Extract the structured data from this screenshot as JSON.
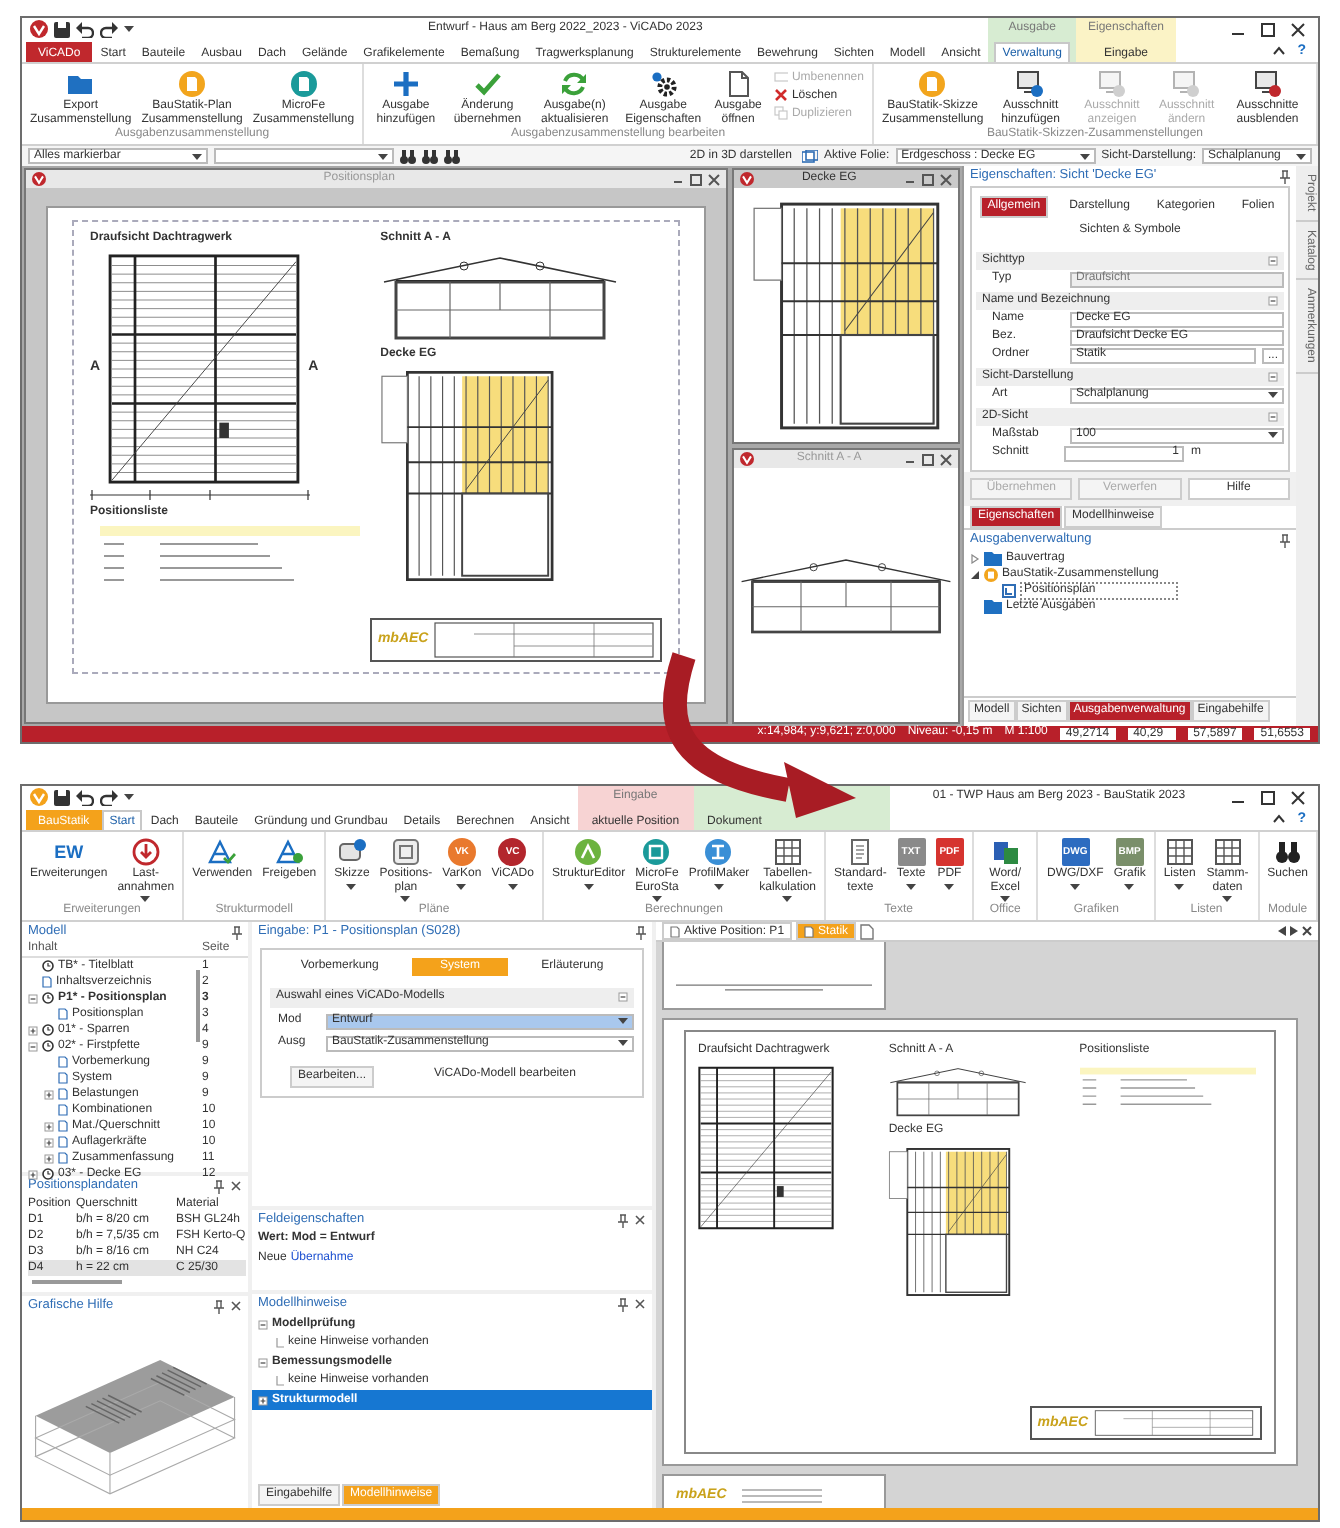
{
  "top_window": {
    "title": "Entwurf - Haus am Berg 2022_2023 - ViCADo 2023",
    "app_tab": "ViCADo",
    "help": "?",
    "tabs": [
      {
        "label": "Start",
        "selected": false
      },
      {
        "label": "Bauteile",
        "selected": false
      },
      {
        "label": "Ausbau",
        "selected": false
      },
      {
        "label": "Dach",
        "selected": false
      },
      {
        "label": "Gelände",
        "selected": false
      },
      {
        "label": "Grafikelemente",
        "selected": false
      },
      {
        "label": "Bemaßung",
        "selected": false
      },
      {
        "label": "Tragwerksplanung",
        "selected": false
      },
      {
        "label": "Strukturelemente",
        "selected": false
      },
      {
        "label": "Bewehrung",
        "selected": false
      },
      {
        "label": "Sichten",
        "selected": false
      },
      {
        "label": "Modell",
        "selected": false
      },
      {
        "label": "Ansicht",
        "selected": false
      }
    ],
    "context_tabs": [
      {
        "group": "Ausgabe",
        "label": "Verwaltung",
        "selected": true,
        "color": "#d7ecd2"
      },
      {
        "group": "Eigenschaften",
        "label": "Eingabe",
        "selected": false,
        "color": "#fbf3c6"
      }
    ],
    "ribbon": [
      {
        "label": "Ausgabenzusammenstellung",
        "buttons": [
          {
            "label": "Export Zusammenstellung",
            "disabled": false
          },
          {
            "label": "BauStatik-Plan Zusammenstellung",
            "disabled": false
          },
          {
            "label": "MicroFe Zusammenstellung",
            "disabled": false
          }
        ]
      },
      {
        "label": "Ausgabenzusammenstellung bearbeiten",
        "buttons": [
          {
            "label": "Ausgabe hinzufügen",
            "disabled": false
          },
          {
            "label": "Änderung übernehmen",
            "disabled": false
          },
          {
            "label": "Ausgabe(n) aktualisieren",
            "disabled": false
          },
          {
            "label": "Ausgabe Eigenschaften",
            "disabled": false
          },
          {
            "label": "Ausgabe öffnen",
            "disabled": false
          }
        ],
        "small_buttons": [
          {
            "label": "Umbenennen",
            "disabled": true
          },
          {
            "label": "Löschen",
            "disabled": false
          },
          {
            "label": "Duplizieren",
            "disabled": true
          }
        ]
      },
      {
        "label": "BauStatik-Skizzen-Zusammenstellungen",
        "buttons": [
          {
            "label": "BauStatik-Skizze Zusammenstellung",
            "disabled": false
          },
          {
            "label": "Ausschnitt hinzufügen",
            "disabled": false
          },
          {
            "label": "Ausschnitt anzeigen",
            "disabled": true
          },
          {
            "label": "Ausschnitt ändern",
            "disabled": true
          },
          {
            "label": "Ausschnitte ausblenden",
            "disabled": false
          }
        ]
      }
    ],
    "toolbar": {
      "filter": "Alles markierbar",
      "view_3d": "2D in 3D darstellen",
      "layer_label": "Aktive Folie:",
      "layer": "Erdgeschoss : Decke EG",
      "display_label": "Sicht-Darstellung:",
      "display": "Schalplanung"
    },
    "plan_window": {
      "title": "Positionsplan",
      "sheet": {
        "plan_title": "Draufsicht Dachtragwerk",
        "section_title": "Schnitt A - A",
        "deck_title": "Decke EG",
        "section_marks": [
          "A",
          "A"
        ],
        "list_title": "Positionsliste",
        "logo": "mbAEC"
      }
    },
    "deck_window": {
      "title": "Decke EG"
    },
    "section_window": {
      "title": "Schnitt A - A"
    },
    "properties": {
      "title": "Eigenschaften: Sicht 'Decke EG'",
      "tabs": [
        {
          "label": "Allgemein",
          "selected": true
        },
        {
          "label": "Darstellung",
          "selected": false
        },
        {
          "label": "Kategorien",
          "selected": false
        },
        {
          "label": "Folien",
          "selected": false
        },
        {
          "label": "Sichten & Symbole",
          "selected": false
        }
      ],
      "groups": [
        {
          "label": "Sichttyp",
          "rows": [
            {
              "label": "Typ",
              "value": "Draufsicht",
              "kind": "readonly"
            }
          ]
        },
        {
          "label": "Name und Bezeichnung",
          "rows": [
            {
              "label": "Name",
              "value": "Decke EG",
              "kind": "text"
            },
            {
              "label": "Bez.",
              "value": "Draufsicht Decke EG",
              "kind": "text"
            },
            {
              "label": "Ordner",
              "value": "Statik",
              "kind": "browse",
              "button": "..."
            }
          ]
        },
        {
          "label": "Sicht-Darstellung",
          "rows": [
            {
              "label": "Art",
              "value": "Schalplanung",
              "kind": "dropdown"
            }
          ]
        },
        {
          "label": "2D-Sicht",
          "rows": [
            {
              "label": "Maßstab",
              "value": "100",
              "kind": "dropdown"
            },
            {
              "label": "Schnitt",
              "value": "1",
              "unit": "m",
              "kind": "number"
            }
          ]
        }
      ],
      "buttons": [
        {
          "label": "Übernehmen",
          "disabled": true
        },
        {
          "label": "Verwerfen",
          "disabled": true
        },
        {
          "label": "Hilfe",
          "disabled": false
        }
      ]
    },
    "panel_tabs": [
      {
        "label": "Eigenschaften",
        "selected": true
      },
      {
        "label": "Modellhinweise",
        "selected": false
      }
    ],
    "output_manager": {
      "title": "Ausgabenverwaltung",
      "items": [
        {
          "label": "Bauvertrag",
          "kind": "folder",
          "expanded": false
        },
        {
          "label": "BauStatik-Zusammenstellung",
          "kind": "compilation",
          "expanded": true,
          "children": [
            {
              "label": "Positionsplan",
              "kind": "plan",
              "selected": true
            }
          ]
        },
        {
          "label": "Letzte Ausgaben",
          "kind": "folder"
        }
      ]
    },
    "bottom_tabs": [
      {
        "label": "Modell",
        "selected": false
      },
      {
        "label": "Sichten",
        "selected": false
      },
      {
        "label": "Ausgabenverwaltung",
        "selected": true
      },
      {
        "label": "Eingabehilfe",
        "selected": false
      }
    ],
    "side_tabs": [
      "Projekt",
      "Katalog",
      "Anmerkungen"
    ],
    "status": {
      "coords": "x:14,984; y:9,621; z:0,000",
      "floor": "Niveau: -0,15 m",
      "scale": "M 1:100",
      "fields": [
        "49,2714",
        "40,29",
        "57,5897",
        "51,6553"
      ]
    }
  },
  "bottom_window": {
    "title": "01 - TWP Haus am Berg 2023 - BauStatik 2023",
    "app_tab": "BauStatik",
    "help": "?",
    "tabs": [
      {
        "label": "Start",
        "selected": true
      },
      {
        "label": "Dach",
        "selected": false
      },
      {
        "label": "Bauteile",
        "selected": false
      },
      {
        "label": "Gründung und Grundbau",
        "selected": false
      },
      {
        "label": "Details",
        "selected": false
      },
      {
        "label": "Berechnen",
        "selected": false
      },
      {
        "label": "Ansicht",
        "selected": false
      }
    ],
    "context_tabs": [
      {
        "group": "Eingabe",
        "label": "aktuelle Position",
        "selected": false,
        "color": "#f7d3d3"
      },
      {
        "label": "Dokument",
        "selected": false,
        "color": "#d7ecd2"
      }
    ],
    "ribbon": [
      {
        "label": "Erweiterungen",
        "buttons": [
          {
            "label": "Erweiterungen",
            "badge": "EW",
            "dropdown": false
          },
          {
            "label": "Last-annahmen",
            "dropdown": true
          }
        ]
      },
      {
        "label": "Strukturmodell",
        "buttons": [
          {
            "label": "Verwenden",
            "dropdown": false
          },
          {
            "label": "Freigeben",
            "dropdown": false
          }
        ]
      },
      {
        "label": "Pläne",
        "buttons": [
          {
            "label": "Skizze",
            "dropdown": true
          },
          {
            "label": "Positions-plan",
            "dropdown": true
          },
          {
            "label": "VarKon",
            "badge": "VK",
            "dropdown": true
          },
          {
            "label": "ViCADo",
            "badge": "VC",
            "dropdown": true
          }
        ]
      },
      {
        "label": "Berechnungen",
        "buttons": [
          {
            "label": "StrukturEditor",
            "dropdown": true
          },
          {
            "label": "MicroFe EuroSta",
            "dropdown": true
          },
          {
            "label": "ProfilMaker",
            "dropdown": true
          },
          {
            "label": "Tabellen-kalkulation",
            "dropdown": true
          }
        ]
      },
      {
        "label": "Texte",
        "buttons": [
          {
            "label": "Standard-texte",
            "dropdown": false
          },
          {
            "label": "Texte",
            "badge": "TXT",
            "dropdown": true
          },
          {
            "label": "PDF",
            "badge": "PDF",
            "dropdown": true
          }
        ]
      },
      {
        "label": "Office",
        "buttons": [
          {
            "label": "Word/ Excel",
            "dropdown": true
          }
        ]
      },
      {
        "label": "Grafiken",
        "buttons": [
          {
            "label": "DWG/DXF",
            "badge": "DWG",
            "dropdown": true
          },
          {
            "label": "Grafik",
            "badge": "BMP",
            "dropdown": true
          }
        ]
      },
      {
        "label": "Listen",
        "buttons": [
          {
            "label": "Listen",
            "dropdown": true
          },
          {
            "label": "Stamm-daten",
            "dropdown": true
          }
        ]
      },
      {
        "label": "Module",
        "buttons": [
          {
            "label": "Suchen",
            "dropdown": false
          }
        ]
      }
    ],
    "model": {
      "title": "Modell",
      "columns": [
        "Inhalt",
        "Seite"
      ],
      "items": [
        {
          "label": "TB* - Titelblatt",
          "page": "1",
          "kind": "position",
          "current": false
        },
        {
          "label": "Inhaltsverzeichnis",
          "page": "2",
          "kind": "page",
          "current": false
        },
        {
          "label": "P1* - Positionsplan",
          "page": "3",
          "kind": "position",
          "current": true,
          "expanded": true,
          "children": [
            {
              "label": "Positionsplan",
              "page": "3",
              "kind": "page"
            }
          ]
        },
        {
          "label": "01* - Sparren",
          "page": "4",
          "kind": "position",
          "current": false,
          "expanded": false
        },
        {
          "label": "02* - Firstpfette",
          "page": "9",
          "kind": "position",
          "current": false,
          "expanded": true,
          "children": [
            {
              "label": "Vorbemerkung",
              "page": "9",
              "kind": "page"
            },
            {
              "label": "System",
              "page": "9",
              "kind": "page"
            },
            {
              "label": "Belastungen",
              "page": "9",
              "kind": "page",
              "expanded": false
            },
            {
              "label": "Kombinationen",
              "page": "10",
              "kind": "page"
            },
            {
              "label": "Mat./Querschnitt",
              "page": "10",
              "kind": "page",
              "expanded": false
            },
            {
              "label": "Auflagerkräfte",
              "page": "10",
              "kind": "page",
              "expanded": false
            },
            {
              "label": "Zusammenfassung",
              "page": "11",
              "kind": "page",
              "expanded": false
            }
          ]
        },
        {
          "label": "03* - Decke EG",
          "page": "12",
          "kind": "position",
          "current": false,
          "expanded": false
        }
      ]
    },
    "plan_data": {
      "title": "Positionsplandaten",
      "columns": [
        "Position",
        "Querschnitt",
        "Material"
      ],
      "rows": [
        {
          "cells": [
            "D1",
            "b/h = 8/20 cm",
            "BSH GL24h"
          ],
          "selected": false
        },
        {
          "cells": [
            "D2",
            "b/h = 7,5/35 cm",
            "FSH Kerto-Q"
          ],
          "selected": false
        },
        {
          "cells": [
            "D3",
            "b/h = 8/16 cm",
            "NH C24"
          ],
          "selected": false
        },
        {
          "cells": [
            "D4",
            "h = 22 cm",
            "C 25/30"
          ],
          "selected": true
        }
      ]
    },
    "graphic_help": {
      "title": "Grafische Hilfe"
    },
    "input": {
      "title": "Eingabe: P1 - Positionsplan (S028)",
      "tabs": [
        {
          "label": "Vorbemerkung",
          "selected": false
        },
        {
          "label": "System",
          "selected": true
        },
        {
          "label": "Erläuterung",
          "selected": false
        }
      ],
      "group": "Auswahl eines ViCADo-Modells",
      "rows": [
        {
          "label": "Mod",
          "value": "Entwurf",
          "selected": true
        },
        {
          "label": "Ausg",
          "value": "BauStatik-Zusammenstellung",
          "selected": false
        }
      ],
      "button": "Bearbeiten...",
      "button_hint": "ViCADo-Modell bearbeiten"
    },
    "field_properties": {
      "title": "Feldeigenschaften",
      "value": "Wert: Mod = Entwurf",
      "new_prefix": "Neue",
      "new_link": "Übernahme"
    },
    "model_notes": {
      "title": "Modellhinweise",
      "items": [
        {
          "label": "Modellprüfung",
          "expanded": true,
          "selected": false,
          "children": [
            {
              "label": "keine Hinweise vorhanden"
            }
          ]
        },
        {
          "label": "Bemessungsmodelle",
          "expanded": true,
          "selected": false,
          "children": [
            {
              "label": "keine Hinweise vorhanden"
            }
          ]
        },
        {
          "label": "Strukturmodell",
          "expanded": false,
          "selected": true
        }
      ]
    },
    "middle_tabs": [
      {
        "label": "Eingabehilfe",
        "selected": false
      },
      {
        "label": "Modellhinweise",
        "selected": true
      }
    ],
    "document": {
      "tabs": [
        {
          "label": "Aktive Position: P1",
          "selected": false
        },
        {
          "label": "Statik",
          "selected": true
        }
      ],
      "sheet": {
        "plan_title": "Draufsicht Dachtragwerk",
        "section_title": "Schnitt A - A",
        "deck_title": "Decke EG",
        "list_title": "Positionsliste",
        "logo": "mbAEC"
      },
      "next_logo": "mbAEC"
    }
  }
}
